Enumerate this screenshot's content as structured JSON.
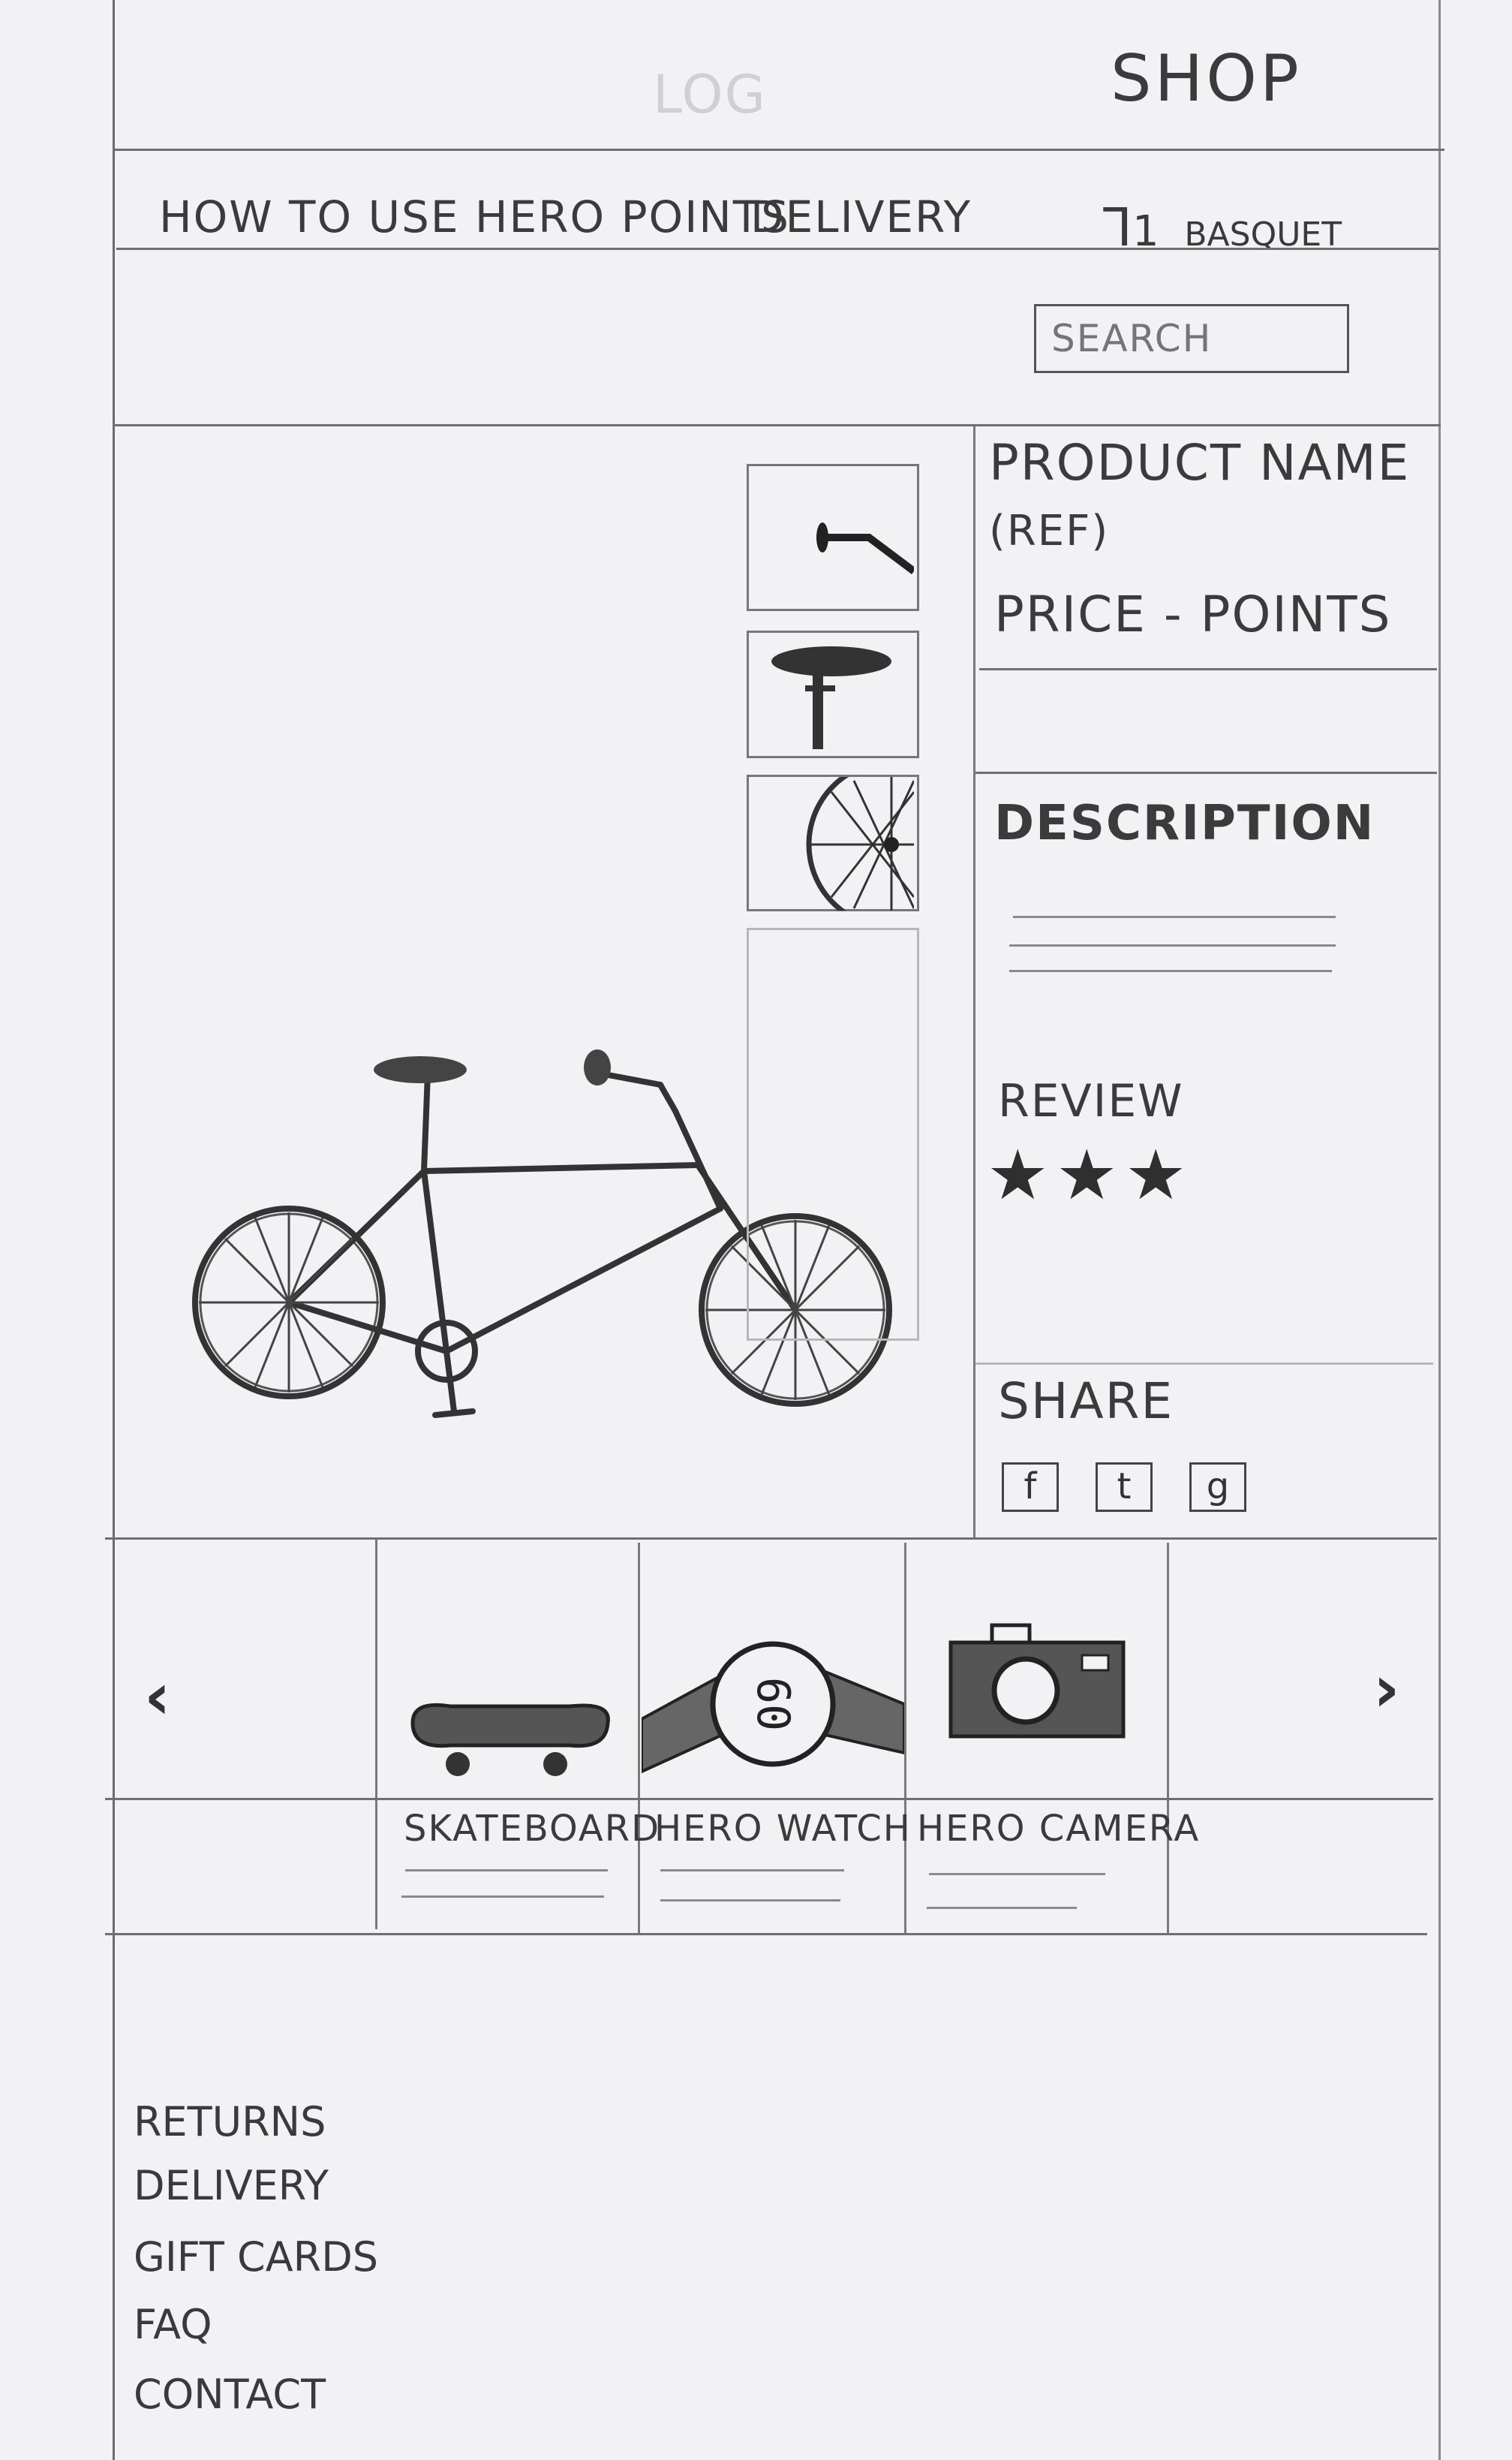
{
  "header": {
    "logo_text": "LOG",
    "shop_title": "SHOP"
  },
  "nav": {
    "items": [
      {
        "label": "HOW TO USE HERO POINTS"
      },
      {
        "label": "DELIVERY"
      }
    ],
    "basket": {
      "count": "1",
      "label": "BASQUET"
    }
  },
  "search": {
    "placeholder": "SEARCH"
  },
  "product": {
    "name": "PRODUCT NAME",
    "ref": "(REF)",
    "price": "PRICE - POINTS",
    "description_heading": "DESCRIPTION",
    "review_heading": "REVIEW",
    "rating_stars": 3,
    "share_heading": "SHARE",
    "share_icons": [
      "f",
      "t",
      "g"
    ],
    "thumbnails": [
      "handlebar",
      "saddle",
      "wheel"
    ]
  },
  "carousel": {
    "prev_icon": "chevron-left-icon",
    "next_icon": "chevron-right-icon",
    "items": [
      {
        "label": "SKATEBOARD",
        "icon": "skateboard-icon"
      },
      {
        "label": "HERO WATCH",
        "icon": "watch-icon"
      },
      {
        "label": "HERO CAMERA",
        "icon": "camera-icon"
      }
    ]
  },
  "footer": {
    "links": [
      "RETURNS",
      "DELIVERY",
      "GIFT CARDS",
      "FAQ",
      "CONTACT"
    ]
  }
}
